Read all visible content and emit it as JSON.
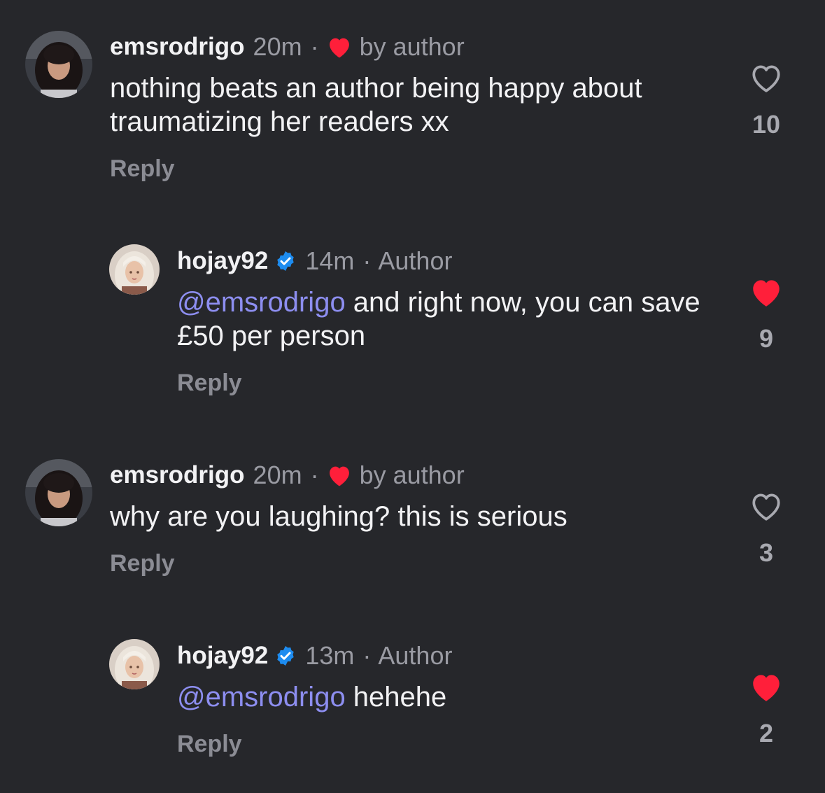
{
  "colors": {
    "background": "#26272b",
    "mention": "#8d8ef0",
    "heart_red": "#ff1f3a",
    "verified_blue": "#1d8cf0"
  },
  "comments": [
    {
      "username": "emsrodrigo",
      "time": "20m",
      "separator": "·",
      "tag": "by author",
      "liked_by_author": true,
      "avatar_icon": "user-avatar-photo",
      "text": "nothing beats an author being happy about traumatizing her readers xx",
      "reply_label": "Reply",
      "like_count": "10",
      "liked": false
    },
    {
      "username": "hojay92",
      "verified": true,
      "time": "14m",
      "separator": "·",
      "tag": "Author",
      "avatar_icon": "illustrated-avatar",
      "mention": "@emsrodrigo",
      "text": " and right now, you can save £50 per person",
      "reply_label": "Reply",
      "like_count": "9",
      "liked": true
    },
    {
      "username": "emsrodrigo",
      "time": "20m",
      "separator": "·",
      "tag": "by author",
      "liked_by_author": true,
      "avatar_icon": "user-avatar-photo",
      "text": "why are you laughing? this is serious",
      "reply_label": "Reply",
      "like_count": "3",
      "liked": false
    },
    {
      "username": "hojay92",
      "verified": true,
      "time": "13m",
      "separator": "·",
      "tag": "Author",
      "avatar_icon": "illustrated-avatar",
      "mention": "@emsrodrigo",
      "text": " hehehe",
      "reply_label": "Reply",
      "like_count": "2",
      "liked": true
    }
  ]
}
